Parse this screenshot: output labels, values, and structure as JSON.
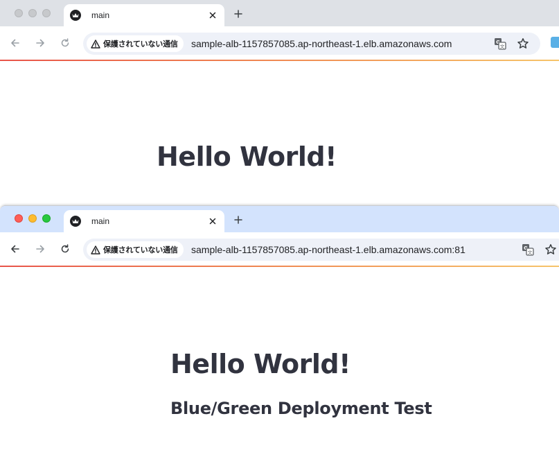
{
  "windows": [
    {
      "tab": {
        "title": "main"
      },
      "omnibox": {
        "security_label": "保護されていない通信",
        "url": "sample-alb-1157857085.ap-northeast-1.elb.amazonaws.com"
      },
      "page": {
        "heading": "Hello World!"
      }
    },
    {
      "tab": {
        "title": "main"
      },
      "omnibox": {
        "security_label": "保護されていない通信",
        "url": "sample-alb-1157857085.ap-northeast-1.elb.amazonaws.com:81"
      },
      "page": {
        "heading": "Hello World!",
        "subheading": "Blue/Green Deployment Test"
      }
    }
  ],
  "icons": {
    "back": "back-arrow-icon",
    "forward": "forward-arrow-icon",
    "reload": "reload-icon",
    "warning": "warning-triangle-icon",
    "translate": "translate-icon",
    "bookmark": "bookmark-star-icon",
    "favicon": "crown-favicon-icon",
    "close": "close-icon",
    "new_tab": "plus-icon"
  },
  "colors": {
    "inactive_tabbar": "#dee1e6",
    "active_tabbar": "#d3e3fd",
    "heading_text": "#31333f",
    "accent_line_start": "#e8544a",
    "accent_line_end": "#f6c46a"
  }
}
